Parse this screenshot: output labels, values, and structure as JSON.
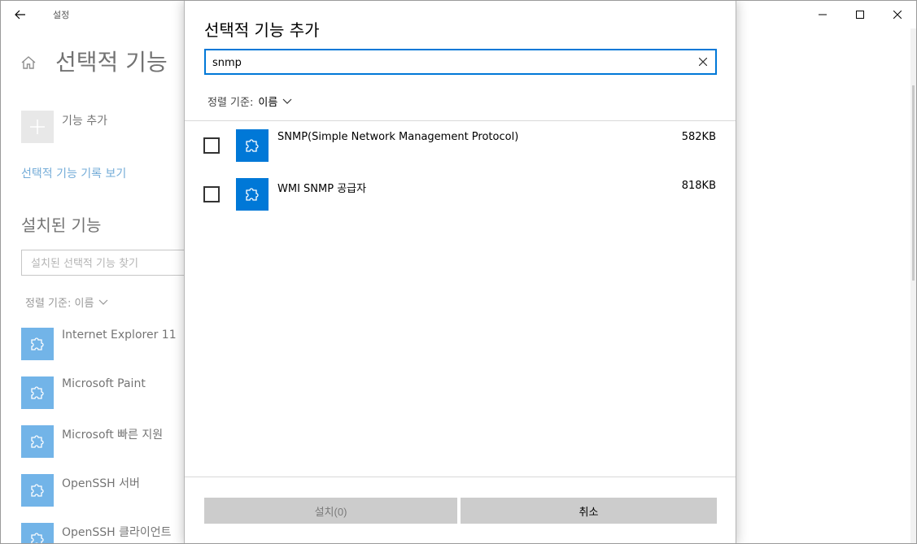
{
  "window": {
    "app_title": "설정"
  },
  "background": {
    "page_title": "선택적 기능",
    "add_feature_label": "기능 추가",
    "history_link": "선택적 기능 기록 보기",
    "installed_title": "설치된 기능",
    "installed_search_placeholder": "설치된 선택적 기능 찾기",
    "sort_label": "정렬 기준: 이름",
    "installed_items": [
      {
        "label": "Internet Explorer 11"
      },
      {
        "label": "Microsoft Paint"
      },
      {
        "label": "Microsoft 빠른 지원"
      },
      {
        "label": "OpenSSH 서버"
      },
      {
        "label": "OpenSSH 클라이언트"
      }
    ]
  },
  "dialog": {
    "title": "선택적 기능 추가",
    "search_value": "snmp",
    "sort_prefix": "정렬 기준:",
    "sort_value": "이름",
    "features": [
      {
        "name": "SNMP(Simple Network Management Protocol)",
        "size": "582KB",
        "checked": false
      },
      {
        "name": "WMI SNMP 공급자",
        "size": "818KB",
        "checked": false
      }
    ],
    "install_button": "설치(0)",
    "cancel_button": "취소"
  },
  "colors": {
    "accent": "#0078d7",
    "link": "#0067b8",
    "button_bg": "#cccccc"
  },
  "icons": {
    "back": "back-arrow-icon",
    "home": "home-icon",
    "add": "plus-icon",
    "feature": "puzzle-icon",
    "clear": "close-icon",
    "sort": "chevron-down-icon"
  }
}
